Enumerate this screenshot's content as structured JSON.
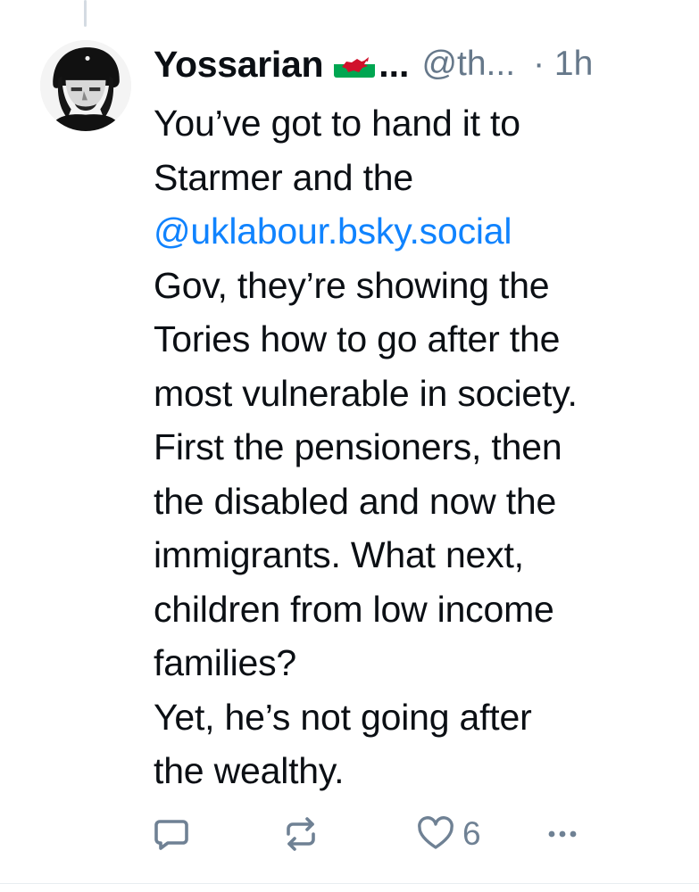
{
  "post": {
    "author": {
      "display_name": "Yossarian",
      "flag_icon": "wales-flag-icon",
      "name_ellipsis": "...",
      "handle": "@th...",
      "avatar_icon": "profile-photo"
    },
    "timestamp": "· 1h",
    "text": {
      "line1": "You’ve got to hand it to",
      "line2": "Starmer and the",
      "mention": "@uklabour.bsky.social",
      "line4": "Gov, they’re showing the",
      "line5": "Tories how to go after the",
      "line6": "most vulnerable in society.",
      "line7": "First the pensioners, then",
      "line8": "the disabled and now the",
      "line9": "immigrants. What next,",
      "line10": "children from low income",
      "line11": "families?",
      "line12": "Yet, he’s not going after",
      "line13": "the wealthy."
    },
    "actions": {
      "reply_icon": "reply-icon",
      "repost_icon": "repost-icon",
      "like_icon": "heart-icon",
      "like_count": "6",
      "more_icon": "more-icon"
    }
  },
  "colors": {
    "text": "#0b0f14",
    "muted": "#66788a",
    "mention": "#1083fe",
    "icon": "#6f8194"
  }
}
